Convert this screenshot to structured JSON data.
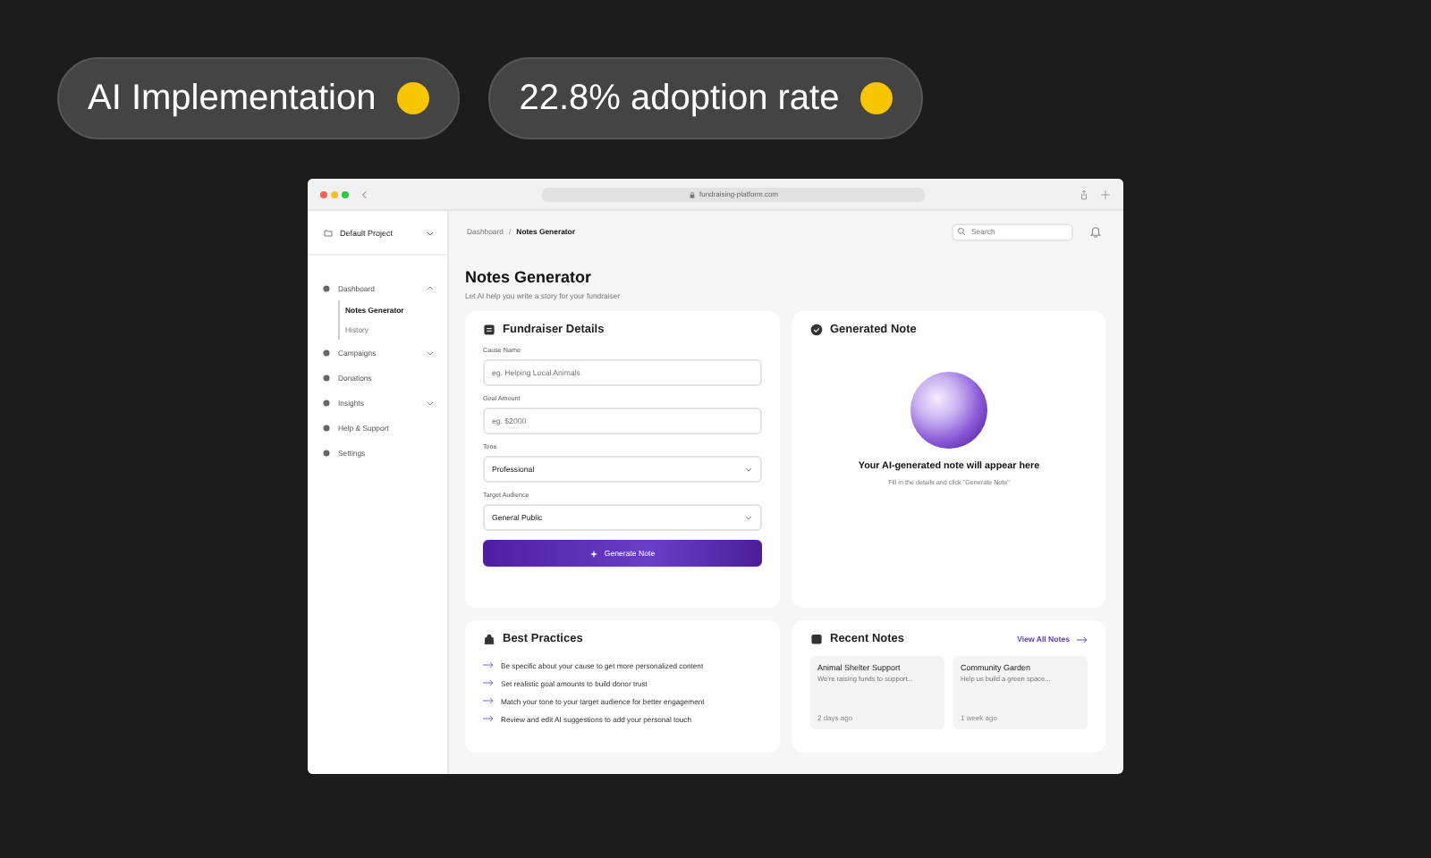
{
  "badges": [
    {
      "label": "AI Implementation",
      "color": "#f7c600"
    },
    {
      "label": "22.8% adoption rate",
      "color": "#f7c600"
    }
  ],
  "browser": {
    "url": "fundraising-platform.com"
  },
  "sidebar": {
    "project": "Default Project",
    "items": [
      {
        "label": "Dashboard",
        "kind": "group",
        "expanded": true,
        "children": [
          {
            "label": "Notes Generator",
            "selected": true
          },
          {
            "label": "History",
            "selected": false
          }
        ]
      },
      {
        "label": "Campaigns",
        "kind": "group",
        "expanded": false
      },
      {
        "label": "Donations",
        "kind": "link"
      },
      {
        "label": "Insights",
        "kind": "group",
        "expanded": false
      },
      {
        "label": "Help & Support",
        "kind": "link"
      },
      {
        "label": "Settings",
        "kind": "link"
      }
    ]
  },
  "header": {
    "breadcrumbs": [
      "Dashboard",
      "Notes Generator"
    ],
    "separator": "/",
    "search": {
      "placeholder": "Search"
    }
  },
  "page": {
    "title": "Notes Generator",
    "subtitle": "Let AI help you write a story for your fundraiser"
  },
  "form": {
    "title": "Fundraiser Details",
    "fields": [
      {
        "label": "Cause Name",
        "kind": "text",
        "placeholder": "eg. Helping Local Animals"
      },
      {
        "label": "Goal Amount",
        "kind": "text",
        "placeholder": "eg. $2000"
      },
      {
        "label": "Tone",
        "kind": "select",
        "value": "Professional"
      },
      {
        "label": "Target Audience",
        "kind": "select",
        "value": "General Public"
      }
    ],
    "button": "Generate Note"
  },
  "generated": {
    "title": "Generated Note",
    "heading": "Your AI-generated note will appear here",
    "hint": "Fill in the details and click \"Generate Note\""
  },
  "practices": {
    "title": "Best Practices",
    "items": [
      "Be specific about your cause to get more personalized content",
      "Set realistic goal amounts to build donor trust",
      "Match your tone to your target audience for better engagement",
      "Review and edit AI suggestions to add your personal touch"
    ]
  },
  "recent": {
    "title": "Recent Notes",
    "link": "View All Notes",
    "notes": [
      {
        "title": "Animal Shelter Support",
        "excerpt": "We're raising funds to support...",
        "time": "2 days ago"
      },
      {
        "title": "Community Garden",
        "excerpt": "Help us build a green space...",
        "time": "1 week ago"
      }
    ]
  }
}
